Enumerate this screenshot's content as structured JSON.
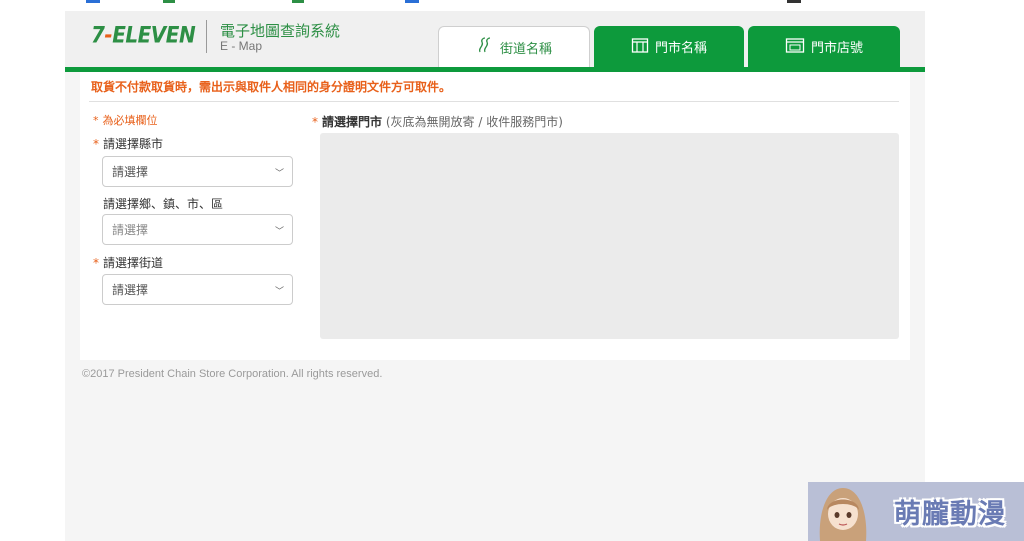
{
  "header": {
    "logo_seven": "7",
    "logo_dash": "-",
    "logo_rest": "ELEVEN",
    "system_title": "電子地圖查詢系統",
    "system_subtitle": "E - Map"
  },
  "tabs": [
    {
      "label": "街道名稱",
      "icon": "road-icon",
      "active": true
    },
    {
      "label": "門市名稱",
      "icon": "store-icon",
      "active": false
    },
    {
      "label": "門市店號",
      "icon": "store-number-icon",
      "active": false
    }
  ],
  "notice": "取貨不付款取貨時，需出示與取件人相同的身分證明文件方可取件。",
  "form": {
    "required_mark": "*",
    "required_note": "為必填欄位",
    "county_label": "請選擇縣市",
    "county_value": "請選擇",
    "town_label": "請選擇鄉、鎮、市、區",
    "town_value": "請選擇",
    "road_label": "請選擇街道",
    "road_value": "請選擇",
    "store_label": "請選擇門市",
    "store_hint": "(灰底為無開放寄 / 收件服務門市)"
  },
  "footer": {
    "copyright": "©2017 President Chain Store Corporation. All rights reserved."
  },
  "watermark": {
    "text": "萌朧動漫"
  },
  "colors": {
    "brand_green": "#0d9a3c",
    "accent_orange": "#e8601a"
  }
}
